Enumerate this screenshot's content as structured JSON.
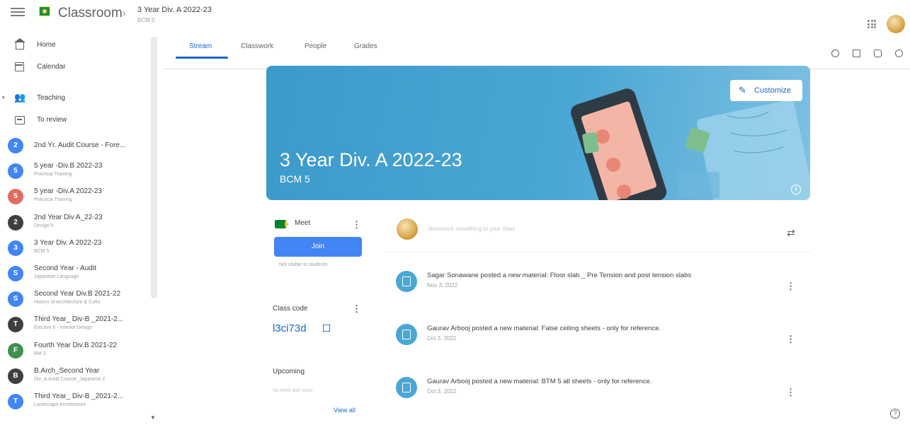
{
  "header": {
    "app_name": "Classroom",
    "separator": "›",
    "class_title": "3 Year Div. A 2022-23",
    "class_section": "BCM 5"
  },
  "sidebar": {
    "home": "Home",
    "calendar": "Calendar",
    "teaching": "Teaching",
    "to_review": "To review",
    "courses": [
      {
        "initial": "2",
        "name": "2nd Yr. Audit Course - Fore...",
        "sub": "",
        "color": "#4285f4"
      },
      {
        "initial": "5",
        "name": "5 year -Div.B 2022-23",
        "sub": "Practical Training",
        "color": "#4285f4"
      },
      {
        "initial": "5",
        "name": "5 year -Div.A 2022-23",
        "sub": "Practical Training",
        "color": "#e46b60"
      },
      {
        "initial": "2",
        "name": "2nd Year Div A_22-23",
        "sub": "Design II",
        "color": "#3c4043"
      },
      {
        "initial": "3",
        "name": "3 Year Div. A 2022-23",
        "sub": "BCM 5",
        "color": "#4285f4"
      },
      {
        "initial": "S",
        "name": "Second Year - Audit",
        "sub": "Japanese Language",
        "color": "#4285f4"
      },
      {
        "initial": "S",
        "name": "Second Year Div.B 2021-22",
        "sub": "History of Architecture & Cultu",
        "color": "#4285f4"
      },
      {
        "initial": "T",
        "name": "Third Year_ Div-B _2021-2...",
        "sub": "Elective II - Interior Design",
        "color": "#3c4043"
      },
      {
        "initial": "F",
        "name": "Fourth Year Div.B 2021-22",
        "sub": "RM 3",
        "color": "#3f8f4f"
      },
      {
        "initial": "B",
        "name": "B.Arch_Second Year",
        "sub": "Div_A Audit Course_Japanese 2",
        "color": "#3c4043"
      },
      {
        "initial": "T",
        "name": "Third Year_ Div-B _2021-2...",
        "sub": "Landscape Architecture",
        "color": "#4285f4"
      }
    ]
  },
  "tabs": [
    "Stream",
    "Classwork",
    "People",
    "Grades"
  ],
  "banner": {
    "title": "3 Year Div. A 2022-23",
    "subtitle": "BCM 5",
    "customize_label": "Customize"
  },
  "meet": {
    "label": "Meet",
    "join_label": "Join",
    "visibility_note": "Not visible to students"
  },
  "class_code": {
    "label": "Class code",
    "code": "l3ci73d"
  },
  "upcoming": {
    "label": "Upcoming",
    "text": "No work due soon",
    "view_all": "View all"
  },
  "stream": {
    "announce_placeholder": "Announce something to your class",
    "posts": [
      {
        "title": "Sagar Sonawane posted a new material: Floor slab _ Pre Tension and post tension slabs",
        "date": "Nov 3, 2022"
      },
      {
        "title": "Gaurav Arbooj posted a new material: False ceiling sheets - only for reference.",
        "date": "Oct 3, 2022"
      },
      {
        "title": "Gaurav Arbooj posted a new material: BTM 5 all sheets - only for reference.",
        "date": "Oct 3, 2022"
      }
    ]
  },
  "colors": {
    "accent": "#1967d2",
    "banner": "#4aa6d4",
    "join": "#4285f4"
  }
}
